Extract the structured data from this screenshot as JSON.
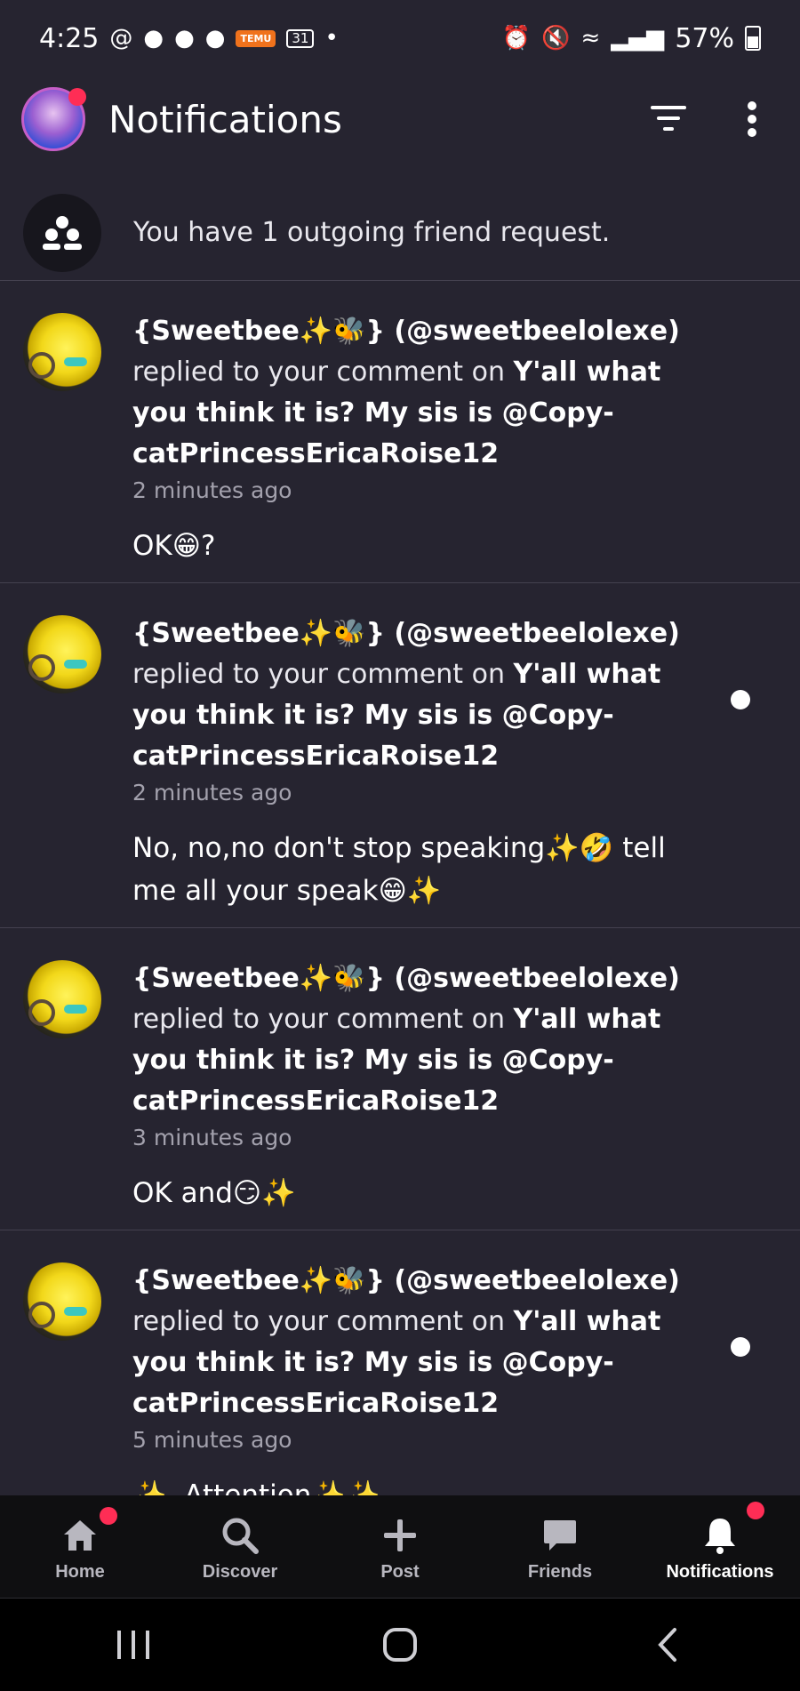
{
  "status_bar": {
    "time": "4:25",
    "app_badge": "TEMU",
    "calendar_day": "31",
    "battery": "57%"
  },
  "header": {
    "title": "Notifications"
  },
  "friend_request": {
    "text": "You have 1 outgoing friend request."
  },
  "notifications": [
    {
      "user": "{Sweetbee✨🐝} (@sweetbeelolexe)",
      "action": "replied to your comment on",
      "post": "Y'all what you think it is? My sis is @Copy-catPrincessEricaRoise12",
      "time": "2 minutes ago",
      "comment": "OK😁?",
      "unread": false
    },
    {
      "user": "{Sweetbee✨🐝} (@sweetbeelolexe)",
      "action": "replied to your comment on",
      "post": "Y'all what you think it is? My sis is @Copy-catPrincessEricaRoise12",
      "time": "2 minutes ago",
      "comment": "No, no,no don't stop speaking✨🤣 tell me all your speak😁✨",
      "unread": true
    },
    {
      "user": "{Sweetbee✨🐝} (@sweetbeelolexe)",
      "action": "replied to your comment on",
      "post": "Y'all what you think it is? My sis is @Copy-catPrincessEricaRoise12",
      "time": "3 minutes ago",
      "comment": "OK and😏✨",
      "unread": false
    },
    {
      "user": "{Sweetbee✨🐝} (@sweetbeelolexe)",
      "action": "replied to your comment on",
      "post": "Y'all what you think it is? My sis is @Copy-catPrincessEricaRoise12",
      "time": "5 minutes ago",
      "comment": "✨. Attention✨✨",
      "unread": true
    }
  ],
  "bottom_nav": {
    "items": [
      {
        "label": "Home",
        "icon": "home-icon",
        "badge": true,
        "active": false
      },
      {
        "label": "Discover",
        "icon": "search-icon",
        "badge": false,
        "active": false
      },
      {
        "label": "Post",
        "icon": "plus-icon",
        "badge": false,
        "active": false
      },
      {
        "label": "Friends",
        "icon": "chat-icon",
        "badge": false,
        "active": false
      },
      {
        "label": "Notifications",
        "icon": "bell-icon",
        "badge": true,
        "active": true
      }
    ]
  },
  "colors": {
    "background": "#262430",
    "nav_background": "#0f0f11",
    "badge": "#ff2d55"
  }
}
